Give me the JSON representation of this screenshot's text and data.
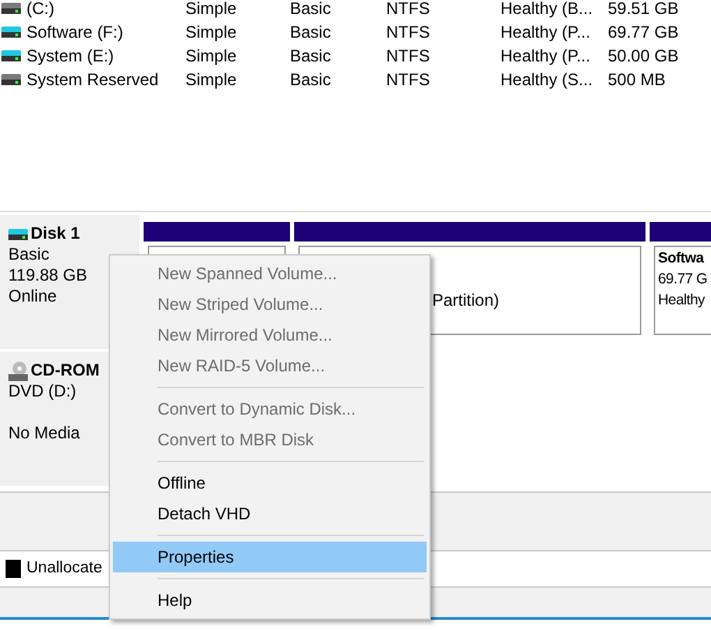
{
  "volumes": [
    {
      "name": "(C:)",
      "layout": "Simple",
      "type": "Basic",
      "file_system": "NTFS",
      "status": "Healthy (B...",
      "capacity": "59.51 GB",
      "color": "#7a7a7a"
    },
    {
      "name": "Software (F:)",
      "layout": "Simple",
      "type": "Basic",
      "file_system": "NTFS",
      "status": "Healthy (P...",
      "capacity": "69.77 GB",
      "color": "#1fc8e0"
    },
    {
      "name": "System (E:)",
      "layout": "Simple",
      "type": "Basic",
      "file_system": "NTFS",
      "status": "Healthy (P...",
      "capacity": "50.00 GB",
      "color": "#1fc8e0"
    },
    {
      "name": "System Reserved",
      "layout": "Simple",
      "type": "Basic",
      "file_system": "NTFS",
      "status": "Healthy (S...",
      "capacity": "500 MB",
      "color": "#7a7a7a"
    }
  ],
  "disks": [
    {
      "kind": "disk",
      "name": "Disk 1",
      "lines": [
        "Basic",
        "119.88 GB",
        "Online"
      ],
      "partitions": [
        {
          "kind": "covered"
        },
        {
          "kind": "volume",
          "lines": [
            "Partition)"
          ]
        },
        {
          "kind": "volume",
          "title": "Softwa",
          "lines": [
            "69.77 G",
            "Healthy"
          ]
        }
      ]
    },
    {
      "kind": "cdrom",
      "name": "CD-ROM",
      "lines": [
        "DVD (D:)"
      ],
      "note": "No Media"
    }
  ],
  "legend": [
    {
      "label": "Unallocate",
      "color": "#000000"
    }
  ],
  "context_menu": {
    "groups": [
      [
        {
          "label": "New Spanned Volume...",
          "disabled": true,
          "selected": false
        },
        {
          "label": "New Striped Volume...",
          "disabled": true,
          "selected": false
        },
        {
          "label": "New Mirrored Volume...",
          "disabled": true,
          "selected": false
        },
        {
          "label": "New RAID-5 Volume...",
          "disabled": true,
          "selected": false
        }
      ],
      [
        {
          "label": "Convert to Dynamic Disk...",
          "disabled": true,
          "selected": false
        },
        {
          "label": "Convert to MBR Disk",
          "disabled": true,
          "selected": false
        }
      ],
      [
        {
          "label": "Offline",
          "disabled": false,
          "selected": false
        },
        {
          "label": "Detach VHD",
          "disabled": false,
          "selected": false
        }
      ],
      [
        {
          "label": "Properties",
          "disabled": false,
          "selected": true
        }
      ],
      [
        {
          "label": "Help",
          "disabled": false,
          "selected": false
        }
      ]
    ]
  }
}
